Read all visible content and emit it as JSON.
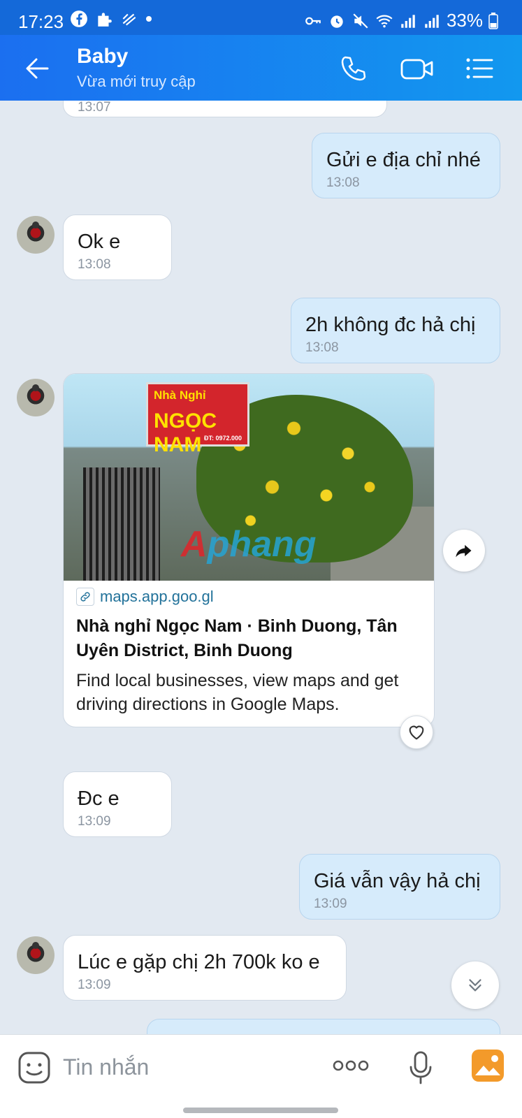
{
  "status_bar": {
    "time": "17:23",
    "battery": "33%"
  },
  "header": {
    "title": "Baby",
    "subtitle": "Vừa mới truy cập"
  },
  "messages": {
    "m0": {
      "time": "13:07"
    },
    "m1": {
      "text": "Gửi e địa chỉ nhé",
      "time": "13:08"
    },
    "m2": {
      "text": "Ok e",
      "time": "13:08"
    },
    "m3": {
      "text": "2h không đc hả chị",
      "time": "13:08"
    },
    "m5": {
      "text": "Đc e",
      "time": "13:09"
    },
    "m6": {
      "text": "Giá vẫn vậy hả chị",
      "time": "13:09"
    },
    "m7": {
      "text": "Lúc e gặp chị 2h 700k ko e",
      "time": "13:09"
    }
  },
  "link_card": {
    "domain": "maps.app.goo.gl",
    "title": "Nhà nghỉ Ngọc Nam · Binh Duong, Tân Uyên District, Binh Duong",
    "description": "Find local businesses, view maps and get driving directions in Google Maps.",
    "image": {
      "sign_line1": "Nhà Nghỉ",
      "sign_line2": "NGỌC NAM",
      "sign_phone": "ĐT: 0972.000",
      "watermark_a": "A",
      "watermark_rest": "phang"
    }
  },
  "composer": {
    "placeholder": "Tin nhắn"
  },
  "colors": {
    "header": "#1b6ff0",
    "outgoing_bubble": "#d6ebfb",
    "chat_bg": "#e2e9f1"
  }
}
